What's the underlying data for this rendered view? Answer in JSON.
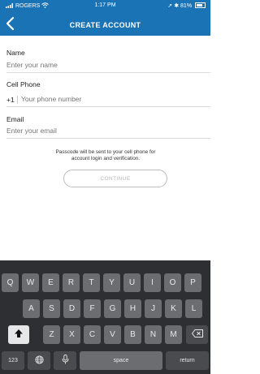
{
  "status_bar": {
    "carrier": "ROGERS",
    "time": "1:17 PM",
    "battery": "81%"
  },
  "nav": {
    "title": "CREATE ACCOUNT"
  },
  "form": {
    "name_label": "Name",
    "name_placeholder": "Enter your name",
    "phone_label": "Cell Phone",
    "phone_prefix": "+1",
    "phone_placeholder": "Your phone number",
    "email_label": "Email",
    "email_placeholder": "Enter your email",
    "note_line1": "Passcode will be sent to your cell phone for",
    "note_line2": "account login and verification.",
    "continue_label": "CONTINUE"
  },
  "keyboard": {
    "row1": [
      "Q",
      "W",
      "E",
      "R",
      "T",
      "Y",
      "U",
      "I",
      "O",
      "P"
    ],
    "row2": [
      "A",
      "S",
      "D",
      "F",
      "G",
      "H",
      "J",
      "K",
      "L"
    ],
    "row3": [
      "Z",
      "X",
      "C",
      "V",
      "B",
      "N",
      "M"
    ],
    "numbers_label": "123",
    "space_label": "space",
    "return_label": "return"
  },
  "colors": {
    "header": "#1a73b5",
    "keyboard_bg": "#2e2f32"
  }
}
